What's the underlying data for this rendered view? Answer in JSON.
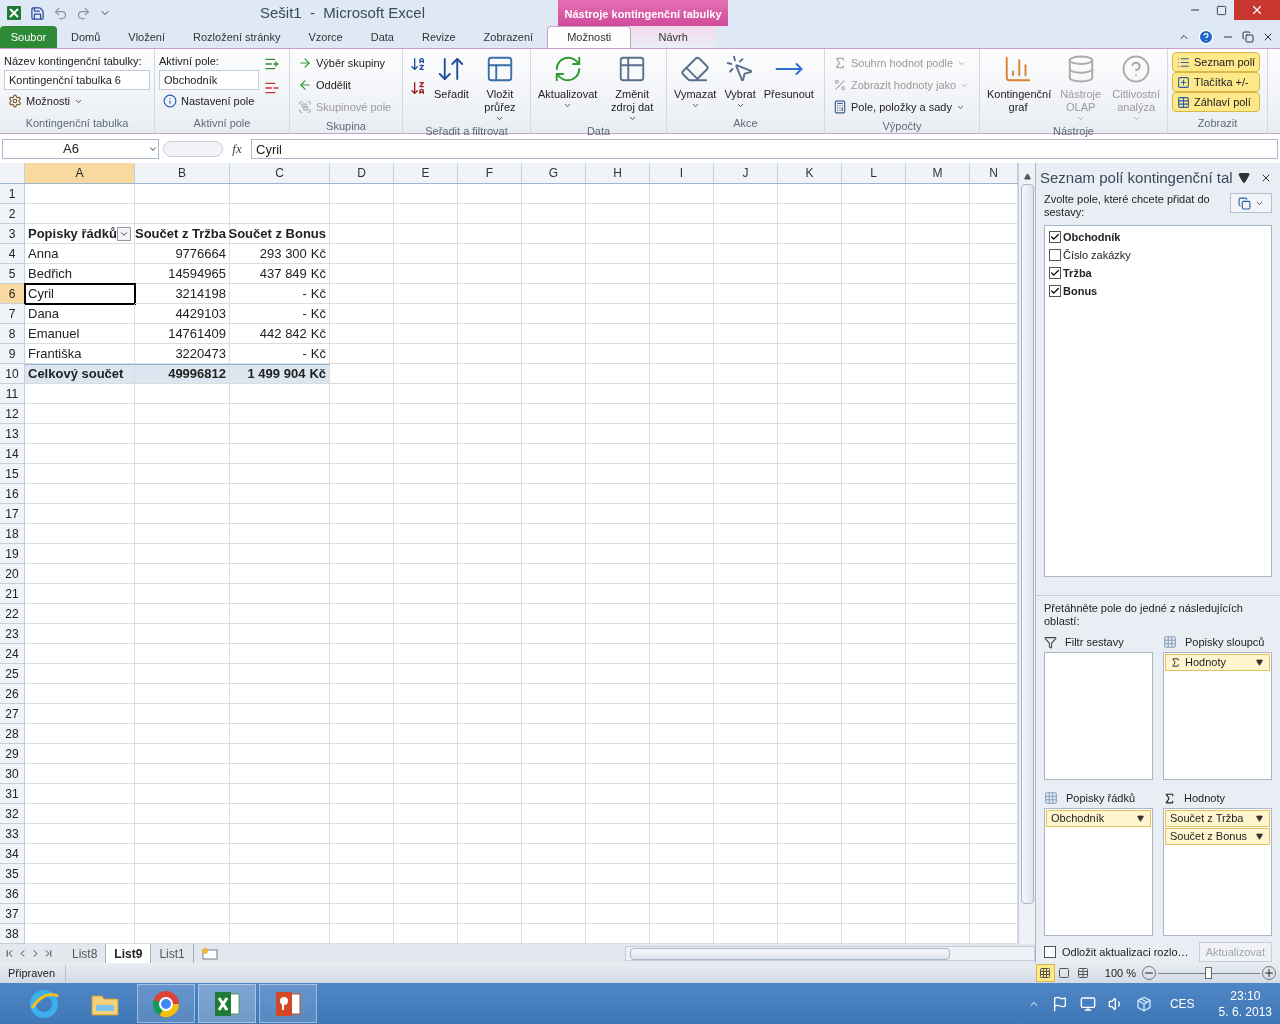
{
  "window": {
    "title": "Sešit1  -  Microsoft Excel",
    "context_group": "Nástroje kontingenční tabulky"
  },
  "ribbon_tabs": [
    {
      "label": "Soubor",
      "kind": "file",
      "selected": false
    },
    {
      "label": "Domů",
      "kind": "normal",
      "selected": false
    },
    {
      "label": "Vložení",
      "kind": "normal",
      "selected": false
    },
    {
      "label": "Rozložení stránky",
      "kind": "normal",
      "selected": false
    },
    {
      "label": "Vzorce",
      "kind": "normal",
      "selected": false
    },
    {
      "label": "Data",
      "kind": "normal",
      "selected": false
    },
    {
      "label": "Revize",
      "kind": "normal",
      "selected": false
    },
    {
      "label": "Zobrazení",
      "kind": "normal",
      "selected": false
    },
    {
      "label": "Možnosti",
      "kind": "context",
      "selected": true
    },
    {
      "label": "Návrh",
      "kind": "context",
      "selected": false
    }
  ],
  "ribbon_groups": [
    {
      "label": "Kontingenční tabulka",
      "columns": [
        [
          {
            "kind": "caption",
            "label": "Název kontingenční tabulky:"
          },
          {
            "kind": "field",
            "value": "Kontingenční tabulka 6"
          },
          {
            "kind": "small",
            "label": "Možnosti",
            "dropdown": true,
            "disabled": false
          }
        ]
      ]
    },
    {
      "label": "Aktivní pole",
      "columns": [
        [
          {
            "kind": "caption",
            "label": "Aktivní pole:"
          },
          {
            "kind": "field",
            "value": "Obchodník"
          },
          {
            "kind": "small",
            "label": "Nastavení pole",
            "dropdown": false,
            "disabled": false
          }
        ],
        [
          {
            "kind": "icon",
            "disabled": false
          },
          {
            "kind": "icon",
            "disabled": false
          }
        ]
      ]
    },
    {
      "label": "Skupina",
      "columns": [
        [
          {
            "kind": "small",
            "label": "Výběr skupiny",
            "dropdown": false,
            "disabled": false
          },
          {
            "kind": "small",
            "label": "Oddělit",
            "dropdown": false,
            "disabled": false
          },
          {
            "kind": "small",
            "label": "Skupinové pole",
            "dropdown": false,
            "disabled": true
          }
        ]
      ]
    },
    {
      "label": "Seřadit a filtrovat",
      "columns": [
        [
          {
            "kind": "icon",
            "disabled": false
          },
          {
            "kind": "icon",
            "disabled": false
          }
        ],
        [
          {
            "kind": "large",
            "label": "Seřadit",
            "dropdown": false,
            "disabled": false
          }
        ],
        [
          {
            "kind": "large",
            "label": "Vložit průřez",
            "dropdown": true,
            "disabled": false
          }
        ]
      ]
    },
    {
      "label": "Data",
      "columns": [
        [
          {
            "kind": "large",
            "label": "Aktualizovat",
            "dropdown": true,
            "disabled": false
          }
        ],
        [
          {
            "kind": "large",
            "label": "Změnit zdroj dat",
            "dropdown": true,
            "disabled": false
          }
        ]
      ]
    },
    {
      "label": "Akce",
      "columns": [
        [
          {
            "kind": "large",
            "label": "Vymazat",
            "dropdown": true,
            "disabled": false
          }
        ],
        [
          {
            "kind": "large",
            "label": "Vybrat",
            "dropdown": true,
            "disabled": false
          }
        ],
        [
          {
            "kind": "large",
            "label": "Přesunout",
            "dropdown": false,
            "disabled": false
          }
        ]
      ]
    },
    {
      "label": "Výpočty",
      "columns": [
        [
          {
            "kind": "small",
            "label": "Souhrn hodnot podle",
            "dropdown": true,
            "disabled": true
          },
          {
            "kind": "small",
            "label": "Zobrazit hodnoty jako",
            "dropdown": true,
            "disabled": true
          },
          {
            "kind": "small",
            "label": "Pole, položky a sady",
            "dropdown": true,
            "disabled": false
          }
        ]
      ]
    },
    {
      "label": "Nástroje",
      "columns": [
        [
          {
            "kind": "large",
            "label": "Kontingenční graf",
            "dropdown": false,
            "disabled": false
          }
        ],
        [
          {
            "kind": "large",
            "label": "Nástroje OLAP",
            "dropdown": true,
            "disabled": true
          }
        ],
        [
          {
            "kind": "large",
            "label": "Citlivostní analýza",
            "dropdown": true,
            "disabled": true
          }
        ]
      ]
    },
    {
      "label": "Zobrazit",
      "columns": [
        [
          {
            "kind": "toggle",
            "label": "Seznam polí",
            "selected": true
          },
          {
            "kind": "toggle",
            "label": "Tlačítka +/-",
            "selected": true
          },
          {
            "kind": "toggle",
            "label": "Záhlaví polí",
            "selected": true
          }
        ]
      ]
    }
  ],
  "formula_bar": {
    "name_box": "A6",
    "function_label": "fx",
    "value": "Cyril"
  },
  "sheet": {
    "columns": [
      {
        "label": "A",
        "selected": true
      },
      {
        "label": "B",
        "selected": false
      },
      {
        "label": "C",
        "selected": false
      },
      {
        "label": "D",
        "selected": false
      },
      {
        "label": "E",
        "selected": false
      },
      {
        "label": "F",
        "selected": false
      },
      {
        "label": "G",
        "selected": false
      },
      {
        "label": "H",
        "selected": false
      },
      {
        "label": "I",
        "selected": false
      },
      {
        "label": "J",
        "selected": false
      },
      {
        "label": "K",
        "selected": false
      },
      {
        "label": "L",
        "selected": false
      },
      {
        "label": "M",
        "selected": false
      },
      {
        "label": "N",
        "selected": false
      }
    ],
    "rows": [
      {
        "number": "1",
        "selected": false
      },
      {
        "number": "2",
        "selected": false
      },
      {
        "number": "3",
        "selected": false,
        "kind": "header",
        "cells": [
          "Popisky řádků",
          "Součet z Tržba",
          "Součet z Bonus"
        ]
      },
      {
        "number": "4",
        "selected": false,
        "kind": "data",
        "cells": [
          "Anna",
          "9776664",
          "293 300"
        ],
        "currency": "Kč"
      },
      {
        "number": "5",
        "selected": false,
        "kind": "data",
        "cells": [
          "Bedřich",
          "14594965",
          "437 849"
        ],
        "currency": "Kč"
      },
      {
        "number": "6",
        "selected": true,
        "kind": "data",
        "cells": [
          "Cyril",
          "3214198",
          "-"
        ],
        "currency": "Kč"
      },
      {
        "number": "7",
        "selected": false,
        "kind": "data",
        "cells": [
          "Dana",
          "4429103",
          "-"
        ],
        "currency": "Kč"
      },
      {
        "number": "8",
        "selected": false,
        "kind": "data",
        "cells": [
          "Emanuel",
          "14761409",
          "442 842"
        ],
        "currency": "Kč"
      },
      {
        "number": "9",
        "selected": false,
        "kind": "data",
        "cells": [
          "Františka",
          "3220473",
          "-"
        ],
        "currency": "Kč"
      },
      {
        "number": "10",
        "selected": false,
        "kind": "total",
        "cells": [
          "Celkový součet",
          "49996812",
          "1 499 904"
        ],
        "currency": "Kč"
      },
      {
        "number": "11",
        "selected": false
      },
      {
        "number": "12",
        "selected": false
      },
      {
        "number": "13",
        "selected": false
      },
      {
        "number": "14",
        "selected": false
      },
      {
        "number": "15",
        "selected": false
      },
      {
        "number": "16",
        "selected": false
      },
      {
        "number": "17",
        "selected": false
      },
      {
        "number": "18",
        "selected": false
      },
      {
        "number": "19",
        "selected": false
      },
      {
        "number": "20",
        "selected": false
      },
      {
        "number": "21",
        "selected": false
      },
      {
        "number": "22",
        "selected": false
      },
      {
        "number": "23",
        "selected": false
      },
      {
        "number": "24",
        "selected": false
      },
      {
        "number": "25",
        "selected": false
      },
      {
        "number": "26",
        "selected": false
      },
      {
        "number": "27",
        "selected": false
      },
      {
        "number": "28",
        "selected": false
      },
      {
        "number": "29",
        "selected": false
      },
      {
        "number": "30",
        "selected": false
      },
      {
        "number": "31",
        "selected": false
      },
      {
        "number": "32",
        "selected": false
      },
      {
        "number": "33",
        "selected": false
      },
      {
        "number": "34",
        "selected": false
      },
      {
        "number": "35",
        "selected": false
      },
      {
        "number": "36",
        "selected": false
      },
      {
        "number": "37",
        "selected": false
      },
      {
        "number": "38",
        "selected": false
      }
    ]
  },
  "sheet_tabs": [
    {
      "label": "List8",
      "selected": false
    },
    {
      "label": "List9",
      "selected": true
    },
    {
      "label": "List1",
      "selected": false
    }
  ],
  "field_list": {
    "title": "Seznam polí kontingenční tal",
    "instruction": "Zvolte pole, které chcete přidat do sestavy:",
    "fields": [
      {
        "label": "Obchodník",
        "checked": true
      },
      {
        "label": "Číslo zakázky",
        "checked": false
      },
      {
        "label": "Tržba",
        "checked": true
      },
      {
        "label": "Bonus",
        "checked": true
      }
    ],
    "areas_instruction": "Přetáhněte pole do jedné z následujících oblastí:",
    "areas": [
      {
        "kind": "filter",
        "title": "Filtr sestavy"
      },
      {
        "kind": "columns",
        "title": "Popisky sloupců",
        "items": [
          "Hodnoty"
        ]
      },
      {
        "kind": "rows",
        "title": "Popisky řádků",
        "items": [
          "Obchodník"
        ]
      },
      {
        "kind": "values",
        "title": "Hodnoty",
        "items": [
          "Součet z Tržba",
          "Součet z Bonus"
        ]
      }
    ],
    "defer": {
      "label": "Odložit aktualizaci rozlo…",
      "checked": false
    },
    "update_button": {
      "label": "Aktualizovat",
      "disabled": true
    }
  },
  "status_bar": {
    "text": "Připraven",
    "views": [
      {
        "selected": true
      },
      {
        "selected": false
      },
      {
        "selected": false
      }
    ],
    "zoom": "100 %",
    "zoom_level": {
      "level": 0.5
    }
  },
  "taskbar": {
    "apps": [
      {
        "running": false,
        "selected": false
      },
      {
        "running": false,
        "selected": false
      },
      {
        "running": true,
        "selected": false
      },
      {
        "running": true,
        "selected": true
      },
      {
        "running": true,
        "selected": false
      }
    ],
    "language": "CES",
    "time": "23:10",
    "date": "5. 6. 2013"
  }
}
